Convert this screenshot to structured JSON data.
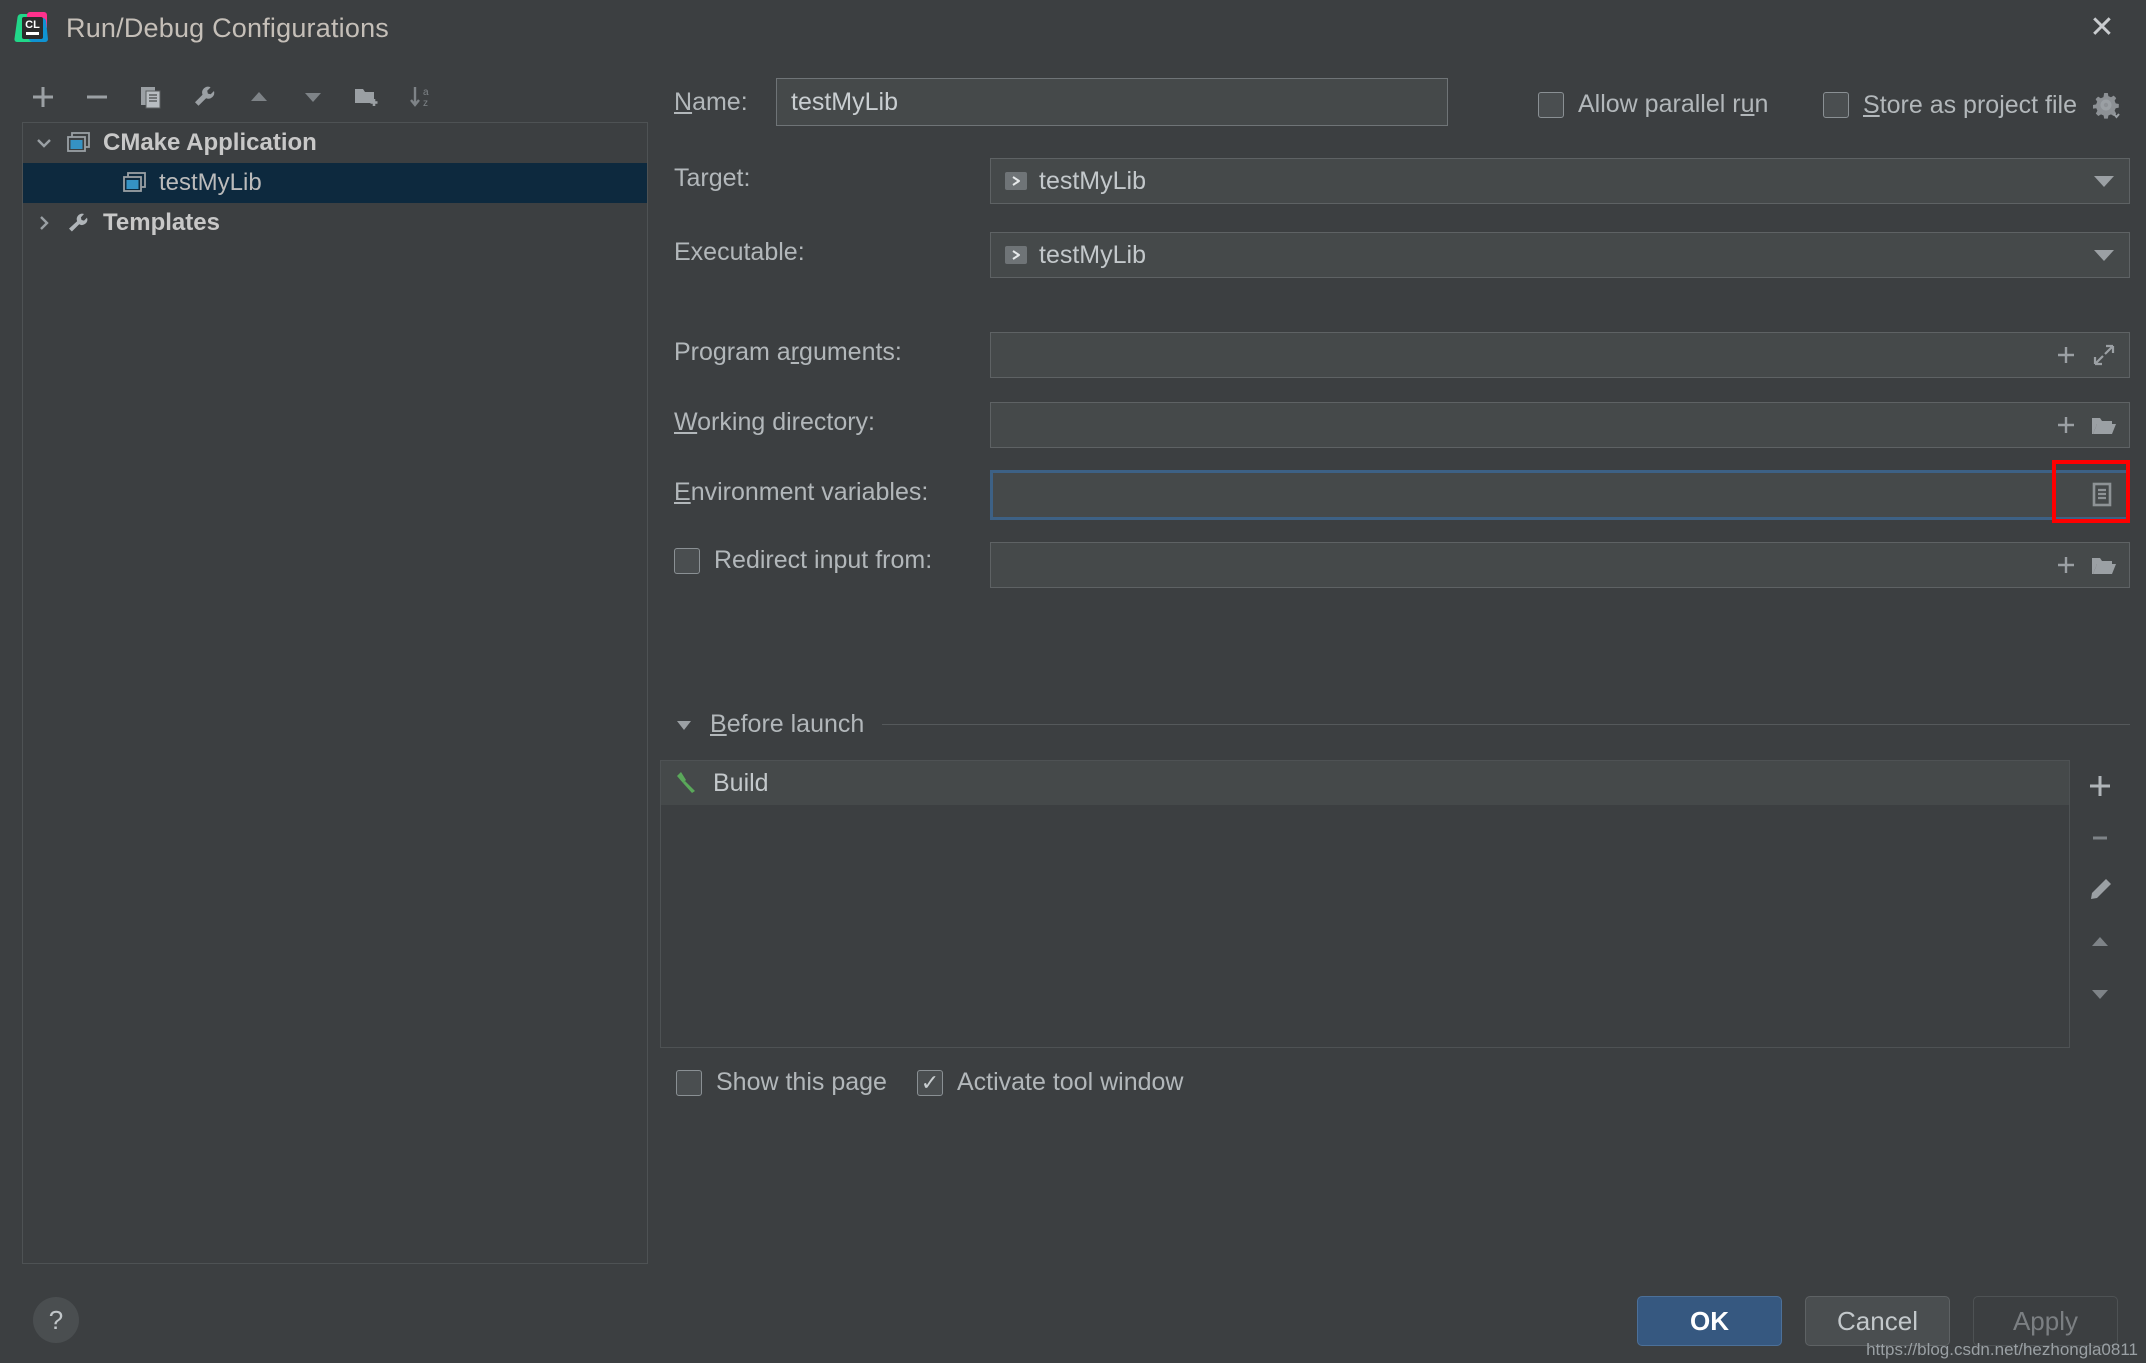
{
  "window": {
    "title": "Run/Debug Configurations",
    "logo_text": "CL",
    "close_icon": "close-icon"
  },
  "toolbar": {
    "buttons": [
      {
        "name": "add-configuration-button",
        "icon": "plus-icon",
        "label": "+"
      },
      {
        "name": "remove-configuration-button",
        "icon": "minus-icon",
        "label": "−"
      },
      {
        "name": "copy-configuration-button",
        "icon": "copy-icon",
        "label": "copy"
      },
      {
        "name": "edit-templates-button",
        "icon": "wrench-icon",
        "label": "wrench"
      },
      {
        "name": "move-up-button",
        "icon": "arrow-up-icon",
        "label": "up"
      },
      {
        "name": "move-down-button",
        "icon": "arrow-down-icon",
        "label": "down"
      },
      {
        "name": "create-folder-button",
        "icon": "folder-add-icon",
        "label": "folder+"
      },
      {
        "name": "sort-configurations-button",
        "icon": "sort-az-icon",
        "label": "sort"
      }
    ]
  },
  "tree": {
    "nodes": [
      {
        "label": "CMake Application",
        "icon": "cmake-application-icon",
        "expanded": true,
        "selected": false,
        "level": 0
      },
      {
        "label": "testMyLib",
        "icon": "cmake-application-icon",
        "expanded": null,
        "selected": true,
        "level": 1
      },
      {
        "label": "Templates",
        "icon": "wrench-icon",
        "expanded": false,
        "selected": false,
        "level": 0
      }
    ]
  },
  "form": {
    "name": {
      "label": "Name:",
      "label_mnemonic": "N",
      "value": "testMyLib",
      "placeholder": ""
    },
    "allow_parallel_run": {
      "label": "Allow parallel run",
      "checked": false
    },
    "store_as_project_file": {
      "label": "Store as project file",
      "checked": false,
      "gear_icon": "gear-icon"
    },
    "target": {
      "label": "Target:",
      "value": "testMyLib",
      "item_icon": "run-target-icon"
    },
    "executable": {
      "label": "Executable:",
      "value": "testMyLib",
      "item_icon": "run-target-icon"
    },
    "program_arguments": {
      "label": "Program arguments:",
      "value": "",
      "placeholder": "",
      "icons": [
        "plus-icon",
        "expand-icon"
      ]
    },
    "working_directory": {
      "label": "Working directory:",
      "value": "",
      "placeholder": "",
      "icons": [
        "plus-icon",
        "folder-icon"
      ]
    },
    "environment_variables": {
      "label": "Environment variables:",
      "value": "",
      "placeholder": "",
      "focused": true,
      "browse_icon": "edit-env-list-icon",
      "highlight_color": "#ff0000"
    },
    "redirect_input": {
      "label": "Redirect input from:",
      "checked": false,
      "value": "",
      "placeholder": "",
      "icons": [
        "plus-icon",
        "folder-icon"
      ]
    }
  },
  "before_launch": {
    "title": "Before launch",
    "expanded": true,
    "items": [
      {
        "label": "Build",
        "icon": "build-hammer-icon"
      }
    ],
    "toolbar": [
      {
        "name": "add-task-button",
        "icon": "plus-icon"
      },
      {
        "name": "remove-task-button",
        "icon": "minus-icon"
      },
      {
        "name": "edit-task-button",
        "icon": "pencil-icon"
      },
      {
        "name": "move-task-up-button",
        "icon": "arrow-up-icon"
      },
      {
        "name": "move-task-down-button",
        "icon": "arrow-down-icon"
      }
    ],
    "show_this_page": {
      "label": "Show this page",
      "checked": false
    },
    "activate_tool_window": {
      "label": "Activate tool window",
      "checked": true
    }
  },
  "footer": {
    "help_label": "?",
    "ok_label": "OK",
    "cancel_label": "Cancel",
    "apply_label": "Apply",
    "apply_enabled": false
  },
  "watermark": "https://blog.csdn.net/hezhongla0811",
  "colors": {
    "background": "#3c3f41",
    "field_background": "#45494a",
    "selection": "#0d293e",
    "accent_blue": "#365880",
    "focus_border": "#3d6185",
    "annotation_red": "#ff0000",
    "build_green": "#5aa85a"
  }
}
